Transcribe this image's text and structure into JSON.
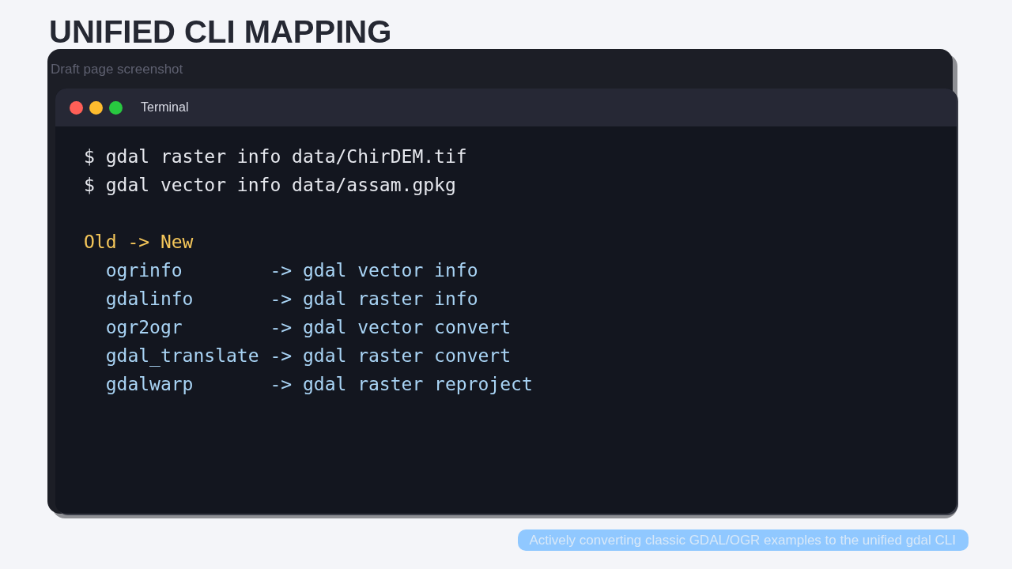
{
  "title": "UNIFIED CLI MAPPING",
  "card": {
    "caption": "Draft page screenshot"
  },
  "terminal": {
    "title": "Terminal",
    "lines": [
      {
        "kind": "command",
        "text": "$ gdal raster info data/ChirDEM.tif"
      },
      {
        "kind": "command",
        "text": "$ gdal vector info data/assam.gpkg"
      },
      {
        "kind": "blank"
      },
      {
        "kind": "header",
        "text": "Old -> New"
      },
      {
        "kind": "mapping",
        "text": "  ogrinfo        -> gdal vector info"
      },
      {
        "kind": "mapping",
        "text": "  gdalinfo       -> gdal raster info"
      },
      {
        "kind": "mapping",
        "text": "  ogr2ogr        -> gdal vector convert"
      },
      {
        "kind": "mapping",
        "text": "  gdal_translate -> gdal raster convert"
      },
      {
        "kind": "mapping",
        "text": "  gdalwarp       -> gdal raster reproject"
      }
    ]
  },
  "footer_badge": "Actively converting classic GDAL/OGR examples to the unified gdal CLI"
}
